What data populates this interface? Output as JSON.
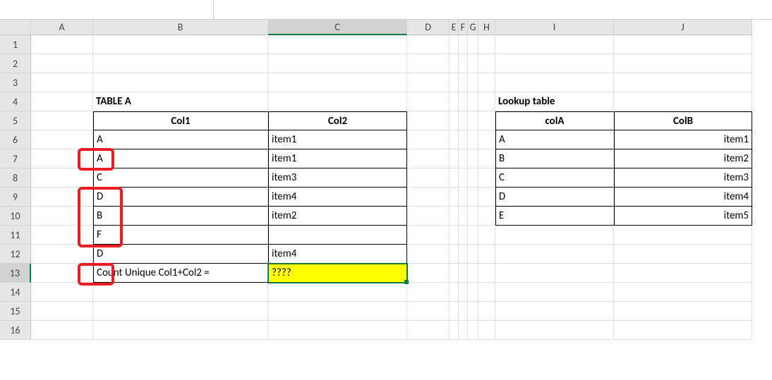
{
  "cols": [
    "A",
    "B",
    "C",
    "D",
    "E",
    "F",
    "G",
    "H",
    "I",
    "J"
  ],
  "rows": [
    "1",
    "2",
    "3",
    "4",
    "5",
    "6",
    "7",
    "8",
    "9",
    "10",
    "11",
    "12",
    "13",
    "14",
    "15",
    "16"
  ],
  "tableA": {
    "title": "TABLE A",
    "headers": {
      "c1": "Col1",
      "c2": "Col2"
    },
    "rows": [
      {
        "c1": "A",
        "c2": "item1"
      },
      {
        "c1": "A",
        "c2": "item1"
      },
      {
        "c1": "C",
        "c2": "item3"
      },
      {
        "c1": "D",
        "c2": "item4"
      },
      {
        "c1": "B",
        "c2": "item2"
      },
      {
        "c1": "F",
        "c2": ""
      },
      {
        "c1": "D",
        "c2": "item4"
      }
    ],
    "summaryLabel": "Count Unique Col1+Col2 =",
    "summaryValue": "????"
  },
  "lookup": {
    "title": "Lookup table",
    "headers": {
      "c1": "colA",
      "c2": "ColB"
    },
    "rows": [
      {
        "a": "A",
        "b": "item1"
      },
      {
        "a": "B",
        "b": "item2"
      },
      {
        "a": "C",
        "b": "item3"
      },
      {
        "a": "D",
        "b": "item4"
      },
      {
        "a": "E",
        "b": "item5"
      }
    ]
  },
  "selectedRow": "13",
  "chart_data": {
    "type": "table",
    "title": "TABLE A and Lookup table",
    "tables": [
      {
        "name": "TABLE A",
        "columns": [
          "Col1",
          "Col2"
        ],
        "rows": [
          [
            "A",
            "item1"
          ],
          [
            "A",
            "item1"
          ],
          [
            "C",
            "item3"
          ],
          [
            "D",
            "item4"
          ],
          [
            "B",
            "item2"
          ],
          [
            "F",
            ""
          ],
          [
            "D",
            "item4"
          ]
        ]
      },
      {
        "name": "Lookup table",
        "columns": [
          "colA",
          "ColB"
        ],
        "rows": [
          [
            "A",
            "item1"
          ],
          [
            "B",
            "item2"
          ],
          [
            "C",
            "item3"
          ],
          [
            "D",
            "item4"
          ],
          [
            "E",
            "item5"
          ]
        ]
      }
    ]
  }
}
